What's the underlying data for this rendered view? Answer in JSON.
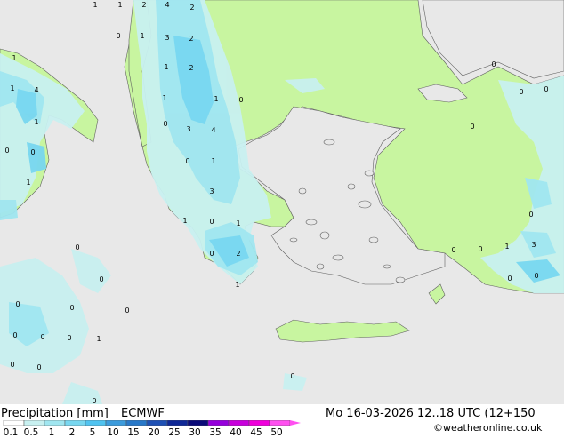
{
  "legend": {
    "title": "Precipitation [mm]",
    "model": "ECMWF",
    "datetime": "Mo 16-03-2026 12..18 UTC (12+150",
    "copyright": "©weatheronline.co.uk",
    "ticks": [
      "0.1",
      "0.5",
      "1",
      "2",
      "5",
      "10",
      "15",
      "20",
      "25",
      "30",
      "35",
      "40",
      "45",
      "50"
    ],
    "colors": [
      "#ffffff",
      "#c8f0f0",
      "#a0e6f0",
      "#78d7f0",
      "#50c3f0",
      "#3c9bdc",
      "#2878c8",
      "#1e50b4",
      "#0f2896",
      "#0a0a78",
      "#9600dc",
      "#c800dc",
      "#f000dc",
      "#ff50f0"
    ]
  },
  "map": {
    "sea_color": "#e8e8e8",
    "land_color": "#c8f5a0",
    "precip_light": "#c8f0f0",
    "precip_mid": "#a0e6f0",
    "precip_heavy": "#78d7f0",
    "values": [
      "1",
      "1",
      "2",
      "4",
      "2",
      "0",
      "1",
      "3",
      "2",
      "1",
      "1",
      "2",
      "4",
      "1",
      "1",
      "0",
      "1",
      "0",
      "3",
      "4",
      "0",
      "0",
      "1",
      "1",
      "3",
      "0",
      "1",
      "0",
      "1",
      "1",
      "0",
      "2",
      "0",
      "1",
      "0",
      "0",
      "0",
      "0",
      "0",
      "0",
      "0",
      "0",
      "0",
      "0",
      "0",
      "0",
      "0",
      "0",
      "0",
      "0",
      "0",
      "0",
      "1",
      "1",
      "0",
      "3",
      "0",
      "0",
      "0",
      "0",
      "0",
      "0",
      "0",
      "0"
    ]
  }
}
